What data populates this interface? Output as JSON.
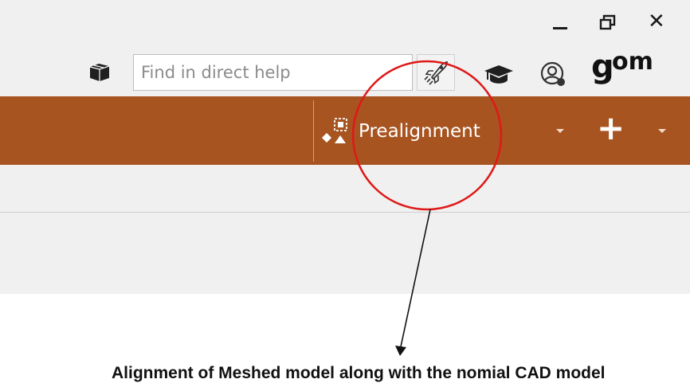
{
  "header": {
    "search": {
      "value": "",
      "placeholder": "Find in direct help"
    },
    "logo_text": "gom",
    "icons": [
      "package-icon",
      "rocket-icon",
      "graduation-cap-icon",
      "user-account-icon"
    ]
  },
  "window_controls": [
    "minimize-icon",
    "restore-icon",
    "close-icon"
  ],
  "ribbon": {
    "color": "#a85420",
    "prealignment_label": "Prealignment",
    "add_icon": "plus-icon"
  },
  "annotation": {
    "caption": "Alignment of Meshed model along with the nomial CAD model",
    "highlight_color": "#e01818"
  }
}
